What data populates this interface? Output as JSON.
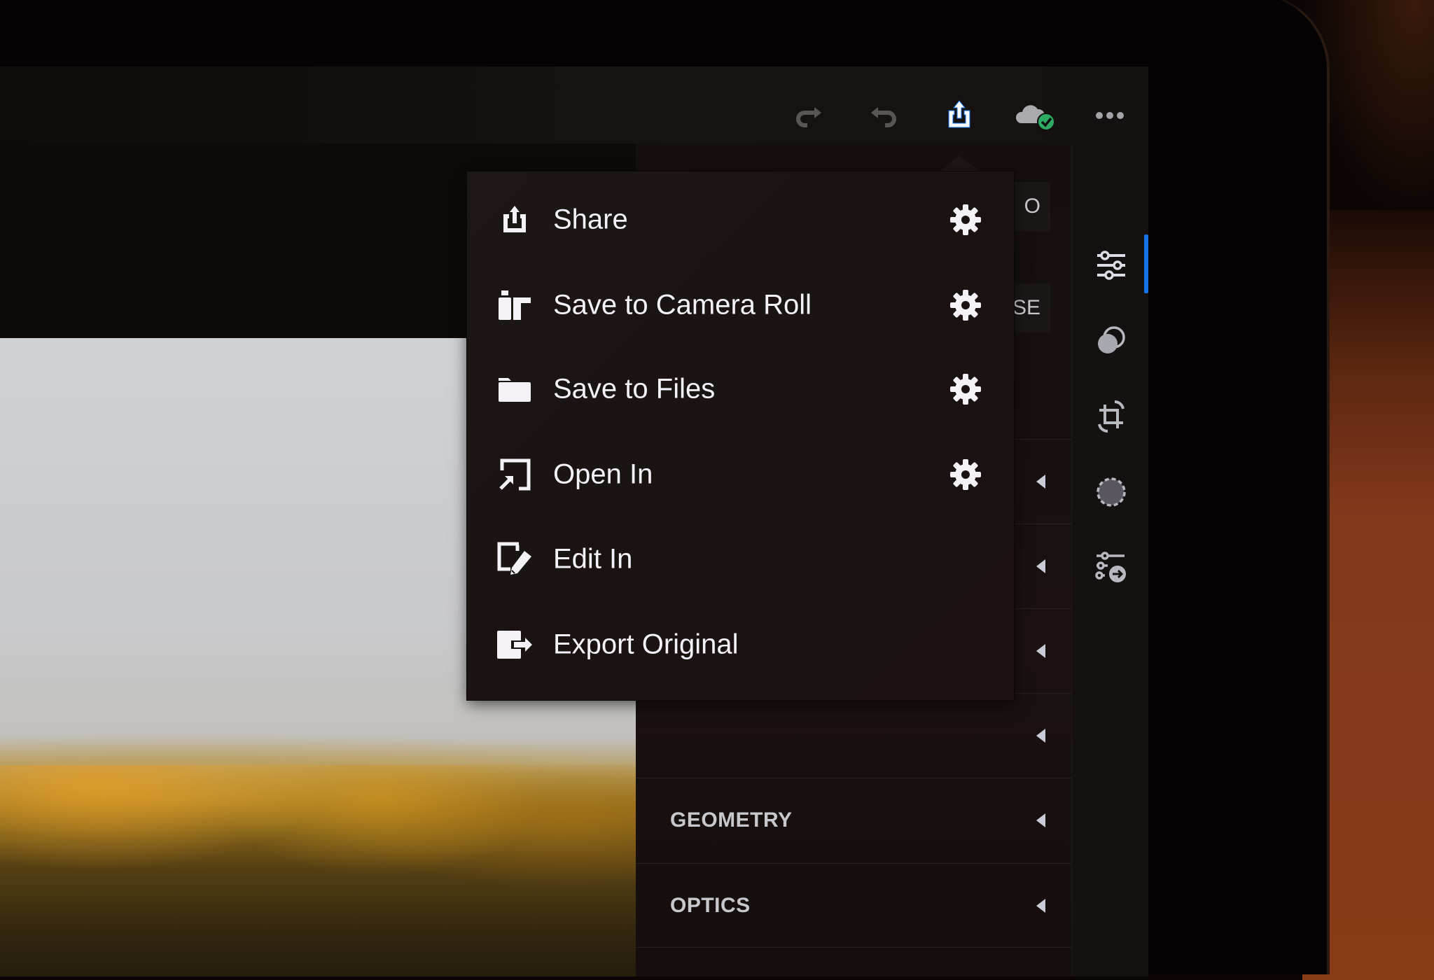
{
  "colors": {
    "accent_blue": "#1473e6",
    "sync_badge_green": "#2dab63",
    "menu_text": "#f4f2f7",
    "panel_text": "#c7c7cc"
  },
  "toolbar": {
    "icons": [
      {
        "name": "redo-icon",
        "enabled": false
      },
      {
        "name": "undo-icon",
        "enabled": false
      },
      {
        "name": "share-icon",
        "active": true
      },
      {
        "name": "cloud-synced-icon",
        "status": "synced"
      },
      {
        "name": "more-icon"
      }
    ]
  },
  "share_menu": {
    "items": [
      {
        "label": "Share",
        "icon": "share-icon",
        "has_settings": true
      },
      {
        "label": "Save to Camera Roll",
        "icon": "camera-roll-icon",
        "has_settings": true
      },
      {
        "label": "Save to Files",
        "icon": "folder-icon",
        "has_settings": true
      },
      {
        "label": "Open In",
        "icon": "open-in-icon",
        "has_settings": true
      },
      {
        "label": "Edit In",
        "icon": "edit-in-icon",
        "has_settings": false
      },
      {
        "label": "Export Original",
        "icon": "export-icon",
        "has_settings": false
      }
    ]
  },
  "edit_panel": {
    "top_buttons": [
      {
        "label": "O",
        "note": "partially hidden"
      },
      {
        "label": "'SE",
        "note": "partially hidden"
      }
    ],
    "sections": [
      {
        "label": "",
        "collapsed": true
      },
      {
        "label": "",
        "collapsed": true
      },
      {
        "label": "",
        "collapsed": true
      },
      {
        "label": "",
        "collapsed": true
      },
      {
        "label": "GEOMETRY",
        "collapsed": true
      },
      {
        "label": "OPTICS",
        "collapsed": true
      }
    ]
  },
  "sidebar": {
    "items": [
      {
        "name": "edit-sliders-icon",
        "active": true
      },
      {
        "name": "masking-icon",
        "active": false
      },
      {
        "name": "crop-rotate-icon",
        "active": false
      },
      {
        "name": "healing-icon",
        "active": false
      },
      {
        "name": "versions-icon",
        "active": false
      }
    ]
  }
}
